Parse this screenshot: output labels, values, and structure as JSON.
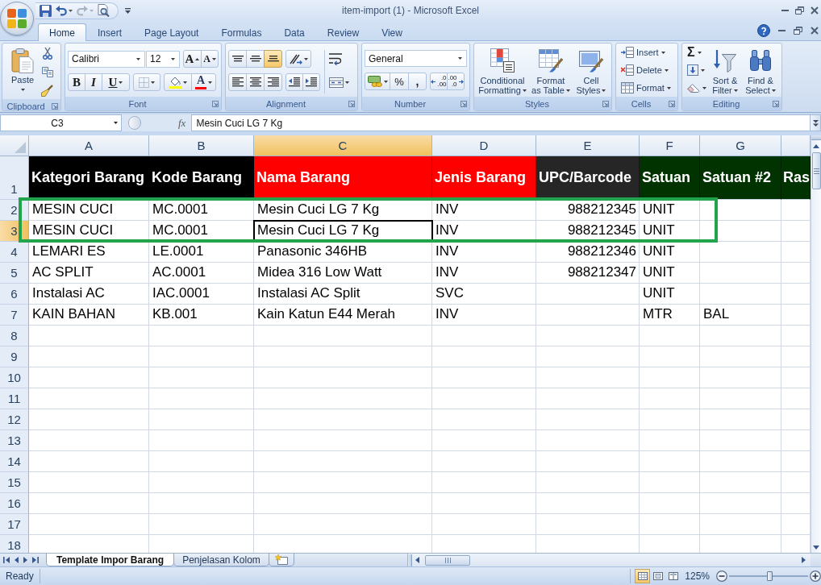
{
  "window": {
    "title": "item-import (1) - Microsoft Excel"
  },
  "quick_access": [
    {
      "kind": "save",
      "disabled": false
    },
    {
      "kind": "undo",
      "disabled": false
    },
    {
      "kind": "redo",
      "disabled": true
    },
    {
      "kind": "print_preview",
      "disabled": false
    }
  ],
  "tabs": [
    {
      "label": "Home",
      "selected": true
    },
    {
      "label": "Insert",
      "selected": false
    },
    {
      "label": "Page Layout",
      "selected": false
    },
    {
      "label": "Formulas",
      "selected": false
    },
    {
      "label": "Data",
      "selected": false
    },
    {
      "label": "Review",
      "selected": false
    },
    {
      "label": "View",
      "selected": false
    }
  ],
  "ribbon": {
    "clipboard": {
      "label": "Clipboard",
      "paste": "Paste"
    },
    "font": {
      "label": "Font",
      "font_name": "Calibri",
      "font_size": "12",
      "grow": "A",
      "shrink": "A",
      "bold": "B",
      "italic": "I",
      "underline": "U",
      "font_color": "A"
    },
    "alignment": {
      "label": "Alignment",
      "vertical": [
        {
          "kind": "top",
          "selected": false
        },
        {
          "kind": "middle",
          "selected": false
        },
        {
          "kind": "bottom",
          "selected": true
        }
      ],
      "horizontal": [
        {
          "kind": "left",
          "selected": false
        },
        {
          "kind": "center",
          "selected": false
        },
        {
          "kind": "right",
          "selected": false
        }
      ]
    },
    "number": {
      "label": "Number",
      "format": "General",
      "percent": "%",
      "comma": ",",
      "increase_decimal": [
        ".0",
        ".00"
      ],
      "decrease_decimal": [
        ".00",
        ".0"
      ]
    },
    "styles": {
      "label": "Styles",
      "buttons": [
        {
          "kind": "conditional",
          "lines": [
            "Conditional",
            "Formatting"
          ]
        },
        {
          "kind": "table",
          "lines": [
            "Format",
            "as Table"
          ]
        },
        {
          "kind": "cell_styles",
          "lines": [
            "Cell",
            "Styles"
          ]
        }
      ]
    },
    "cells": {
      "label": "Cells",
      "buttons": [
        {
          "kind": "insert",
          "label": "Insert"
        },
        {
          "kind": "delete",
          "label": "Delete"
        },
        {
          "kind": "format",
          "label": "Format"
        }
      ]
    },
    "editing": {
      "label": "Editing",
      "sum": "Σ",
      "buttons": [
        {
          "kind": "sort_filter",
          "lines": [
            "Sort &",
            "Filter"
          ]
        },
        {
          "kind": "find_select",
          "lines": [
            "Find &",
            "Select"
          ]
        }
      ]
    }
  },
  "formula_bar": {
    "name_box": "C3",
    "function_label": "fx",
    "formula": "Mesin Cuci LG 7 Kg"
  },
  "columns": [
    {
      "label": "A",
      "selected": false,
      "kind": "text"
    },
    {
      "label": "B",
      "selected": false,
      "kind": "text"
    },
    {
      "label": "C",
      "selected": true,
      "kind": "text"
    },
    {
      "label": "D",
      "selected": false,
      "kind": "text"
    },
    {
      "label": "E",
      "selected": false,
      "kind": "number"
    },
    {
      "label": "F",
      "selected": false,
      "kind": "text"
    },
    {
      "label": "G",
      "selected": false,
      "kind": "text"
    },
    {
      "selected": false,
      "kind": "text"
    }
  ],
  "header_row": {
    "number": "1",
    "selected": false,
    "cells": [
      {
        "text": "Kategori Barang",
        "color": "#000000"
      },
      {
        "text": "Kode Barang",
        "color": "#000000"
      },
      {
        "text": "Nama Barang",
        "color": "#ff0000"
      },
      {
        "text": "Jenis Barang",
        "color": "#ff0000"
      },
      {
        "text": "UPC/Barcode",
        "color": "#262626"
      },
      {
        "text": "Satuan",
        "color": "#003300"
      },
      {
        "text": "Satuan #2",
        "color": "#003300"
      },
      {
        "text": "Ras",
        "color": "#003300"
      }
    ]
  },
  "rows": [
    {
      "number": "2",
      "selected": false,
      "outlined": true,
      "cells": [
        "MESIN CUCI",
        "MC.0001",
        "Mesin Cuci LG 7 Kg",
        "INV",
        "988212345",
        "UNIT"
      ]
    },
    {
      "number": "3",
      "selected": true,
      "outlined": true,
      "cells": [
        "MESIN CUCI",
        "MC.0001",
        "Mesin Cuci LG 7 Kg",
        "INV",
        "988212345",
        "UNIT"
      ]
    },
    {
      "number": "4",
      "selected": false,
      "outlined": false,
      "cells": [
        "LEMARI ES",
        "LE.0001",
        "Panasonic 346HB",
        "INV",
        "988212346",
        "UNIT"
      ]
    },
    {
      "number": "5",
      "selected": false,
      "outlined": false,
      "cells": [
        "AC SPLIT",
        "AC.0001",
        "Midea 316 Low Watt",
        "INV",
        "988212347",
        "UNIT"
      ]
    },
    {
      "number": "6",
      "selected": false,
      "outlined": false,
      "cells": [
        "Instalasi AC",
        "IAC.0001",
        "Instalasi AC Split",
        "SVC",
        null,
        "UNIT"
      ]
    },
    {
      "number": "7",
      "selected": false,
      "outlined": false,
      "cells": [
        "KAIN BAHAN",
        "KB.001",
        "Kain Katun E44 Merah",
        "INV",
        null,
        "MTR",
        "BAL"
      ]
    },
    {
      "number": "8",
      "selected": false,
      "outlined": false
    },
    {
      "number": "9",
      "selected": false,
      "outlined": false
    },
    {
      "number": "10",
      "selected": false,
      "outlined": false
    },
    {
      "number": "11",
      "selected": false,
      "outlined": false
    },
    {
      "number": "12",
      "selected": false,
      "outlined": false
    },
    {
      "number": "13",
      "selected": false,
      "outlined": false
    },
    {
      "number": "14",
      "selected": false,
      "outlined": false
    },
    {
      "number": "15",
      "selected": false,
      "outlined": false
    },
    {
      "number": "16",
      "selected": false,
      "outlined": false
    },
    {
      "number": "17",
      "selected": false,
      "outlined": false
    },
    {
      "number": "18",
      "selected": false,
      "outlined": false
    }
  ],
  "sheet_tabs": [
    {
      "label": "Template Impor Barang",
      "selected": true
    },
    {
      "label": "Penjelasan Kolom",
      "selected": false
    }
  ],
  "status_bar": {
    "status": "Ready",
    "views": [
      {
        "kind": "normal",
        "selected": true
      },
      {
        "kind": "page_layout",
        "selected": false
      },
      {
        "kind": "page_break",
        "selected": false
      }
    ],
    "zoom": "125%",
    "zoom_slider": {
      "level": 0.52
    }
  }
}
